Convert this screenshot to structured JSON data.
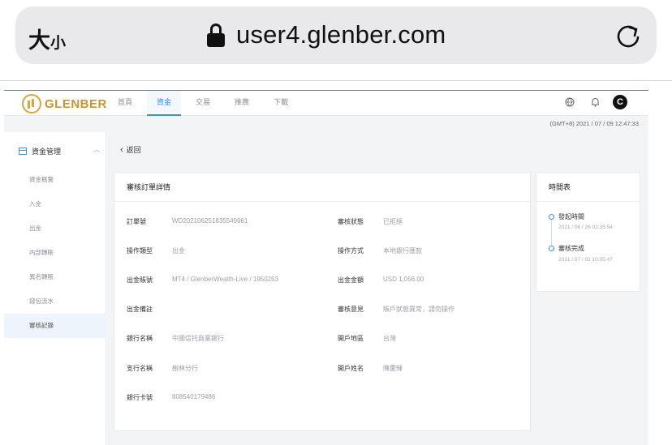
{
  "browser": {
    "text_size_large": "大",
    "text_size_small": "小",
    "url": "user4.glenber.com"
  },
  "site": {
    "logo_text": "GLENBER",
    "nav": [
      {
        "label": "首頁"
      },
      {
        "label": "資金"
      },
      {
        "label": "交易"
      },
      {
        "label": "推廣"
      },
      {
        "label": "下載"
      }
    ],
    "avatar_letter": "C",
    "timestamp": "(GMT+8) 2021 / 07 / 09 12:47:33"
  },
  "sidebar": {
    "group_label": "資金管理",
    "items": [
      {
        "label": "資金概覽"
      },
      {
        "label": "入金"
      },
      {
        "label": "出金"
      },
      {
        "label": "內部轉賬"
      },
      {
        "label": "異名轉賬"
      },
      {
        "label": "錢包流水"
      },
      {
        "label": "審核記錄"
      }
    ]
  },
  "main": {
    "back_label": "返回",
    "card_title": "審核訂單詳情",
    "fields": {
      "order_no_label": "訂單號",
      "order_no_value": "WD202106251835549661",
      "status_label": "審核狀態",
      "status_value": "已拒絕",
      "op_type_label": "操作類型",
      "op_type_value": "出金",
      "op_method_label": "操作方式",
      "op_method_value": "本地銀行匯款",
      "account_label": "出金賬號",
      "account_value": "MT4 / GlenberWealth-Live / 1950253",
      "amount_label": "出金金額",
      "amount_value": "USD 1,056.00",
      "remark_label": "出金備註",
      "remark_value": "",
      "opinion_label": "審核意見",
      "opinion_value": "賬戶狀態異常，請勿操作",
      "bank_label": "銀行名稱",
      "bank_value": "中國信托商業銀行",
      "region_label": "開戶地區",
      "region_value": "台灣",
      "branch_label": "支行名稱",
      "branch_value": "樹林分行",
      "holder_label": "開戶姓名",
      "holder_value": "陳慶輝",
      "card_label": "銀行卡號",
      "card_value": "808540179486"
    }
  },
  "timeline": {
    "title": "時間表",
    "events": [
      {
        "label": "發起時間",
        "time": "2021 / 06 / 26 02:35:54"
      },
      {
        "label": "審核完成",
        "time": "2021 / 07 / 02 10:35:47"
      }
    ]
  }
}
